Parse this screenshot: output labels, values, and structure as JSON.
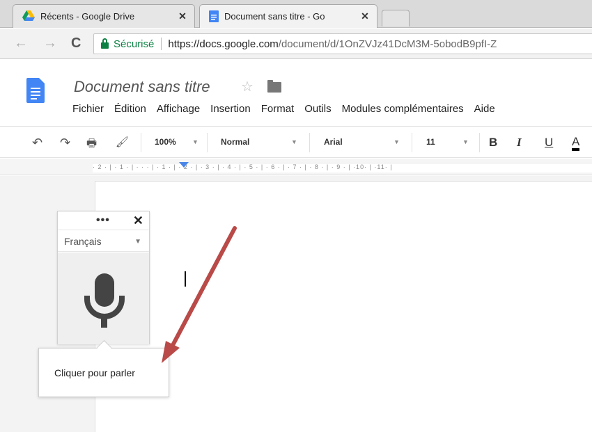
{
  "browser": {
    "tabs": [
      {
        "title": "Récents - Google Drive",
        "close": "✕",
        "icon": "google-drive-icon"
      },
      {
        "title": "Document sans titre - Go",
        "close": "✕",
        "icon": "docs-icon"
      }
    ],
    "secure_label": "Sécurisé",
    "url_host": "https://docs.google.com",
    "url_rest": "/document/d/1OnZVJz41DcM3M-5obodB9pfI-Z"
  },
  "docs": {
    "title": "Document sans titre",
    "menu": [
      "Fichier",
      "Édition",
      "Affichage",
      "Insertion",
      "Format",
      "Outils",
      "Modules complémentaires",
      "Aide"
    ]
  },
  "toolbar": {
    "zoom": "100%",
    "style": "Normal",
    "font": "Arial",
    "size": "11",
    "bold": "B",
    "italic": "I",
    "underline": "U",
    "text_color": "A"
  },
  "ruler": "· 2 · | · 1 · | · · · | · 1 · | · 2 · | · 3 · | · 4 · | · 5 · | · 6 · | · 7 · | · 8 · | · 9 · | ·10· | ·11· |",
  "voice": {
    "dots": "•••",
    "close": "✕",
    "language": "Français",
    "tooltip": "Cliquer pour parler"
  },
  "colors": {
    "accent": "#4285f4",
    "secure": "#0b8043",
    "arrow": "#b94a48"
  }
}
